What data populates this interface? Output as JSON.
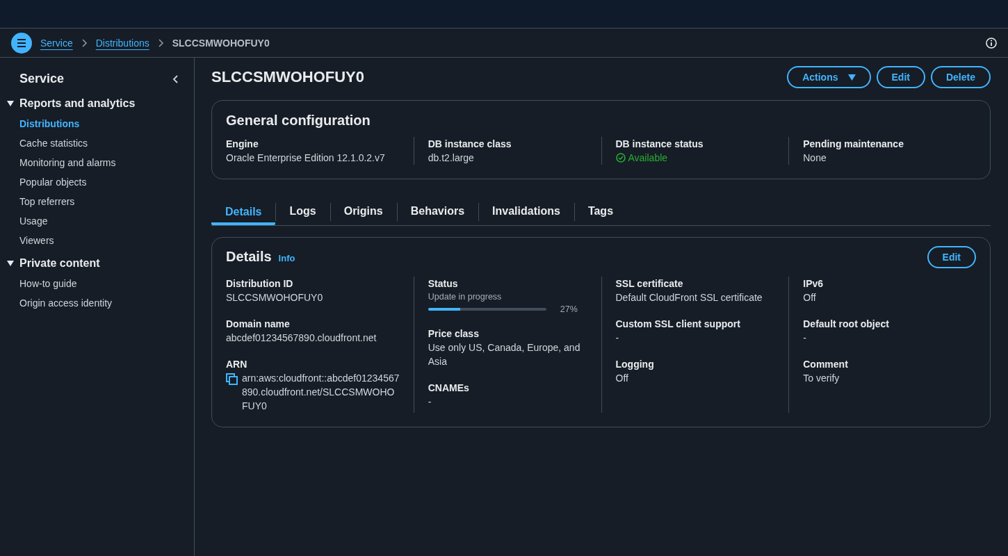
{
  "breadcrumbs": [
    {
      "label": "Service",
      "kind": "link"
    },
    {
      "label": "Distributions",
      "kind": "link"
    },
    {
      "label": "SLCCSMWOHOFUY0",
      "kind": "current"
    }
  ],
  "sidebar": {
    "title": "Service",
    "sections": [
      {
        "title": "Reports and analytics",
        "expanded": true,
        "items": [
          {
            "label": "Distributions",
            "selected": true
          },
          {
            "label": "Cache statistics",
            "selected": false
          },
          {
            "label": "Monitoring and alarms",
            "selected": false
          },
          {
            "label": "Popular objects",
            "selected": false
          },
          {
            "label": "Top referrers",
            "selected": false
          },
          {
            "label": "Usage",
            "selected": false
          },
          {
            "label": "Viewers",
            "selected": false
          }
        ]
      },
      {
        "title": "Private content",
        "expanded": true,
        "items": [
          {
            "label": "How-to guide",
            "selected": false
          },
          {
            "label": "Origin access identity",
            "selected": false
          }
        ]
      }
    ]
  },
  "page": {
    "title": "SLCCSMWOHOFUY0",
    "actions": [
      {
        "label": "Actions",
        "kind": "dropdown"
      },
      {
        "label": "Edit",
        "kind": "button"
      },
      {
        "label": "Delete",
        "kind": "button"
      }
    ]
  },
  "general_configuration": {
    "title": "General configuration",
    "columns": [
      [
        {
          "label": "Engine",
          "kind": "text",
          "value": "Oracle Enterprise Edition 12.1.0.2.v7"
        }
      ],
      [
        {
          "label": "DB instance class",
          "kind": "text",
          "value": "db.t2.large"
        }
      ],
      [
        {
          "label": "DB instance status",
          "kind": "status",
          "value": "Available"
        }
      ],
      [
        {
          "label": "Pending maintenance",
          "kind": "text",
          "value": "None"
        }
      ]
    ]
  },
  "tabs": [
    {
      "label": "Details",
      "selected": true
    },
    {
      "label": "Logs",
      "selected": false
    },
    {
      "label": "Origins",
      "selected": false
    },
    {
      "label": "Behaviors",
      "selected": false
    },
    {
      "label": "Invalidations",
      "selected": false
    },
    {
      "label": "Tags",
      "selected": false
    }
  ],
  "details": {
    "title": "Details",
    "info": "Info",
    "edit": "Edit",
    "columns": [
      [
        {
          "label": "Distribution ID",
          "kind": "text",
          "value": "SLCCSMWOHOFUY0"
        },
        {
          "label": "Domain name",
          "kind": "text",
          "value": "abcdef01234567890.cloudfront.net"
        },
        {
          "label": "ARN",
          "kind": "copy",
          "value": "arn:aws:cloudfront::abcdef01234567890.cloudfront.net/SLCCSMWOHOFUY0"
        }
      ],
      [
        {
          "label": "Status",
          "kind": "progress",
          "value": "Update in progress",
          "level": 0.27,
          "reading": "27%"
        },
        {
          "label": "Price class",
          "kind": "text",
          "value": "Use only US, Canada, Europe, and Asia"
        },
        {
          "label": "CNAMEs",
          "kind": "text",
          "value": "-"
        }
      ],
      [
        {
          "label": "SSL certificate",
          "kind": "text",
          "value": "Default CloudFront SSL certificate"
        },
        {
          "label": "Custom SSL client support",
          "kind": "text",
          "value": "-"
        },
        {
          "label": "Logging",
          "kind": "text",
          "value": "Off"
        }
      ],
      [
        {
          "label": "IPv6",
          "kind": "text",
          "value": "Off"
        },
        {
          "label": "Default root object",
          "kind": "text",
          "value": "-"
        },
        {
          "label": "Comment",
          "kind": "text",
          "value": "To verify"
        }
      ]
    ]
  }
}
